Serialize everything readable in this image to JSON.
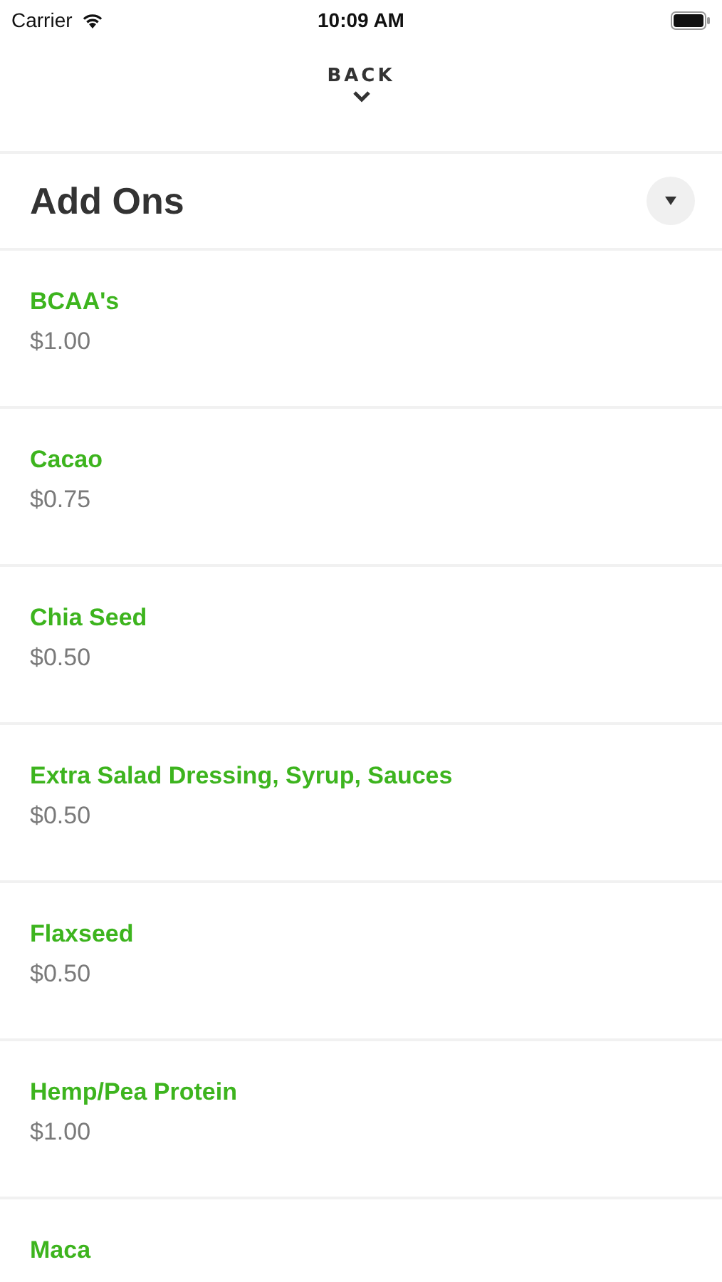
{
  "status_bar": {
    "carrier": "Carrier",
    "time": "10:09 AM"
  },
  "back": {
    "label": "BACK"
  },
  "section": {
    "title": "Add Ons",
    "expanded": true
  },
  "items": [
    {
      "name": "BCAA's",
      "price": "$1.00"
    },
    {
      "name": "Cacao",
      "price": "$0.75"
    },
    {
      "name": "Chia Seed",
      "price": "$0.50"
    },
    {
      "name": "Extra Salad Dressing, Syrup, Sauces",
      "price": "$0.50"
    },
    {
      "name": "Flaxseed",
      "price": "$0.50"
    },
    {
      "name": "Hemp/Pea Protein",
      "price": "$1.00"
    },
    {
      "name": "Maca"
    }
  ]
}
